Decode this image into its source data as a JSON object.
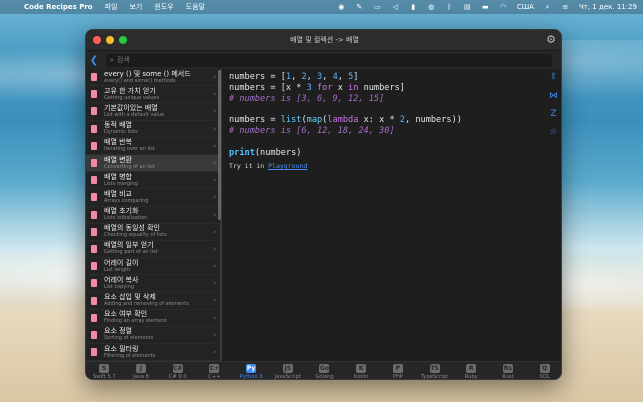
{
  "menubar": {
    "app_name": "Code Recipes Pro",
    "menus": [
      "파일",
      "보기",
      "윈도우",
      "도움말"
    ],
    "keyboard": "США",
    "datetime": "Чт, 1 дек.  11:29"
  },
  "window": {
    "title": "배열 및 컬렉션 -> 배열",
    "search_placeholder": "검색"
  },
  "sidebar": {
    "items": [
      {
        "title": "every () 및 some () 메서드",
        "subtitle": "every() and some() methods"
      },
      {
        "title": "고유 한 가치 얻기",
        "subtitle": "Getting unique values"
      },
      {
        "title": "기본값이있는 배열",
        "subtitle": "List with a default value"
      },
      {
        "title": "동적 배열",
        "subtitle": "Dynamic lists"
      },
      {
        "title": "배열 반복",
        "subtitle": "Iterating over an list"
      },
      {
        "title": "배열 변환",
        "subtitle": "Converting of an list",
        "active": true
      },
      {
        "title": "배열 병합",
        "subtitle": "Lists merging"
      },
      {
        "title": "배열 비교",
        "subtitle": "Arrays comparing"
      },
      {
        "title": "배열 초기화",
        "subtitle": "Lists initialization"
      },
      {
        "title": "배열의 동일성 확인",
        "subtitle": "Checking equality of lists"
      },
      {
        "title": "배열의 일부 얻기",
        "subtitle": "Getting part of an list"
      },
      {
        "title": "어레이 길이",
        "subtitle": "List length"
      },
      {
        "title": "어레이 복사",
        "subtitle": "List copying"
      },
      {
        "title": "요소 삽입 및 삭제",
        "subtitle": "Adding and removing of elements"
      },
      {
        "title": "요소 여부 확인",
        "subtitle": "Finding an array element"
      },
      {
        "title": "요소 정렬",
        "subtitle": "Sorting of elements"
      },
      {
        "title": "요소 필터링",
        "subtitle": "Filtering of elements"
      }
    ]
  },
  "code": {
    "try_prefix": "Try it in ",
    "try_link": "Playground"
  },
  "tabs": [
    {
      "label": "Swift 5.7",
      "icon": "S"
    },
    {
      "label": "Java 8",
      "icon": "J"
    },
    {
      "label": "C# 9.0",
      "icon": "C#"
    },
    {
      "label": "C++",
      "icon": "C+"
    },
    {
      "label": "Python 3",
      "icon": "Py",
      "active": true
    },
    {
      "label": "JavaScript",
      "icon": "JS"
    },
    {
      "label": "Golang",
      "icon": "Go"
    },
    {
      "label": "Kotlin",
      "icon": "K"
    },
    {
      "label": "PHP",
      "icon": "P"
    },
    {
      "label": "TypeScript",
      "icon": "TS"
    },
    {
      "label": "Ruby",
      "icon": "R"
    },
    {
      "label": "Rust",
      "icon": "Rs"
    },
    {
      "label": "SQL",
      "icon": "Q"
    }
  ],
  "colors": {
    "accent": "#3d8ef0",
    "doc_icon": "#f28aa6"
  }
}
